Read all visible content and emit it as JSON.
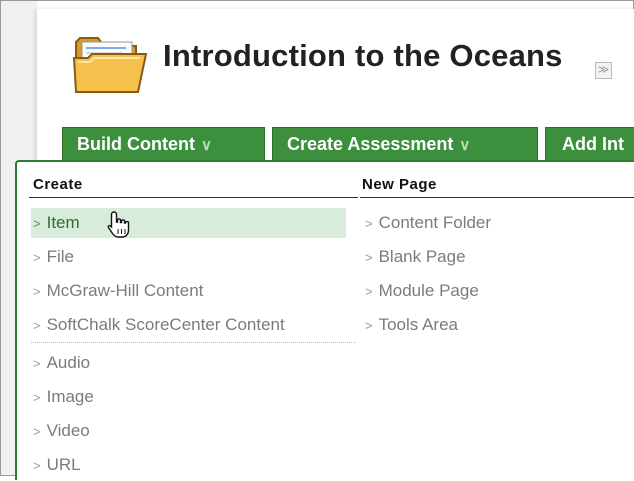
{
  "page": {
    "title": "Introduction to the Oceans",
    "title_menu_icon": "double-chevron-down-icon"
  },
  "action_bar": {
    "buttons": [
      {
        "label": "Build Content",
        "icon": "double-chevron-down-icon"
      },
      {
        "label": "Create Assessment",
        "icon": "double-chevron-down-icon"
      },
      {
        "label": "Add Int"
      }
    ]
  },
  "dropdown": {
    "create": {
      "heading": "Create",
      "items": [
        {
          "label": "Item",
          "highlighted": true
        },
        {
          "label": "File"
        },
        {
          "label": "McGraw-Hill Content"
        },
        {
          "label": "SoftChalk ScoreCenter Content"
        },
        {
          "label": "Audio"
        },
        {
          "label": "Image"
        },
        {
          "label": "Video"
        },
        {
          "label": "URL"
        }
      ]
    },
    "new_page": {
      "heading": "New Page",
      "items": [
        {
          "label": "Content Folder"
        },
        {
          "label": "Blank Page"
        },
        {
          "label": "Module Page"
        },
        {
          "label": "Tools Area"
        }
      ]
    }
  },
  "colors": {
    "accent_green": "#3c8f3c",
    "highlight_bg": "#d8ecdc",
    "item_text": "#7b7b7b"
  }
}
